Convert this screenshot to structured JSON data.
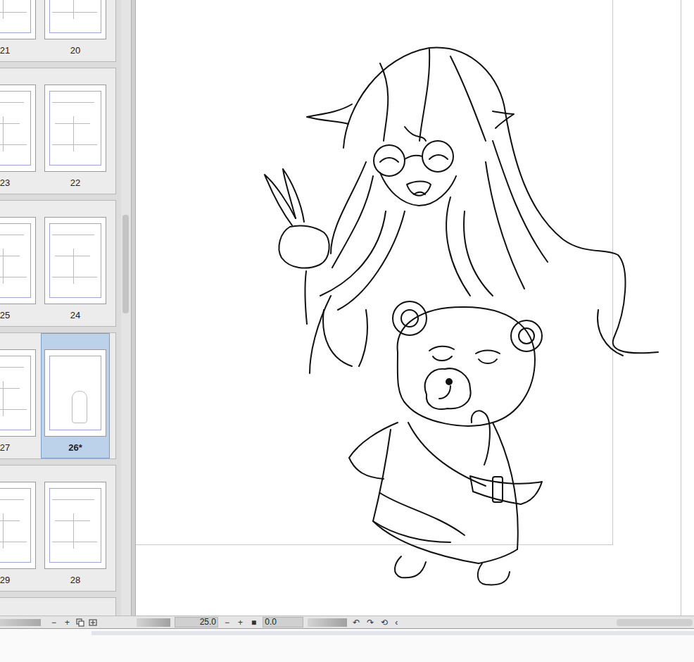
{
  "pages_panel": {
    "groups": [
      {
        "pages": [
          {
            "label": "21",
            "selected": false
          },
          {
            "label": "20",
            "selected": false
          }
        ]
      },
      {
        "pages": [
          {
            "label": "23",
            "selected": false
          },
          {
            "label": "22",
            "selected": false
          }
        ]
      },
      {
        "pages": [
          {
            "label": "25",
            "selected": false
          },
          {
            "label": "24",
            "selected": false
          }
        ]
      },
      {
        "pages": [
          {
            "label": "27",
            "selected": false
          },
          {
            "label": "26*",
            "selected": true
          }
        ]
      },
      {
        "pages": [
          {
            "label": "29",
            "selected": false
          },
          {
            "label": "28",
            "selected": false
          }
        ]
      },
      {
        "pages": []
      }
    ],
    "toolbar": [
      "−",
      "+"
    ]
  },
  "canvas_bar": {
    "zoom": "25.0",
    "zoom_buttons": [
      "−",
      "+",
      "■"
    ],
    "rotation": "0.0",
    "icons": [
      "↶",
      "↷",
      "⟲",
      "‹"
    ]
  }
}
